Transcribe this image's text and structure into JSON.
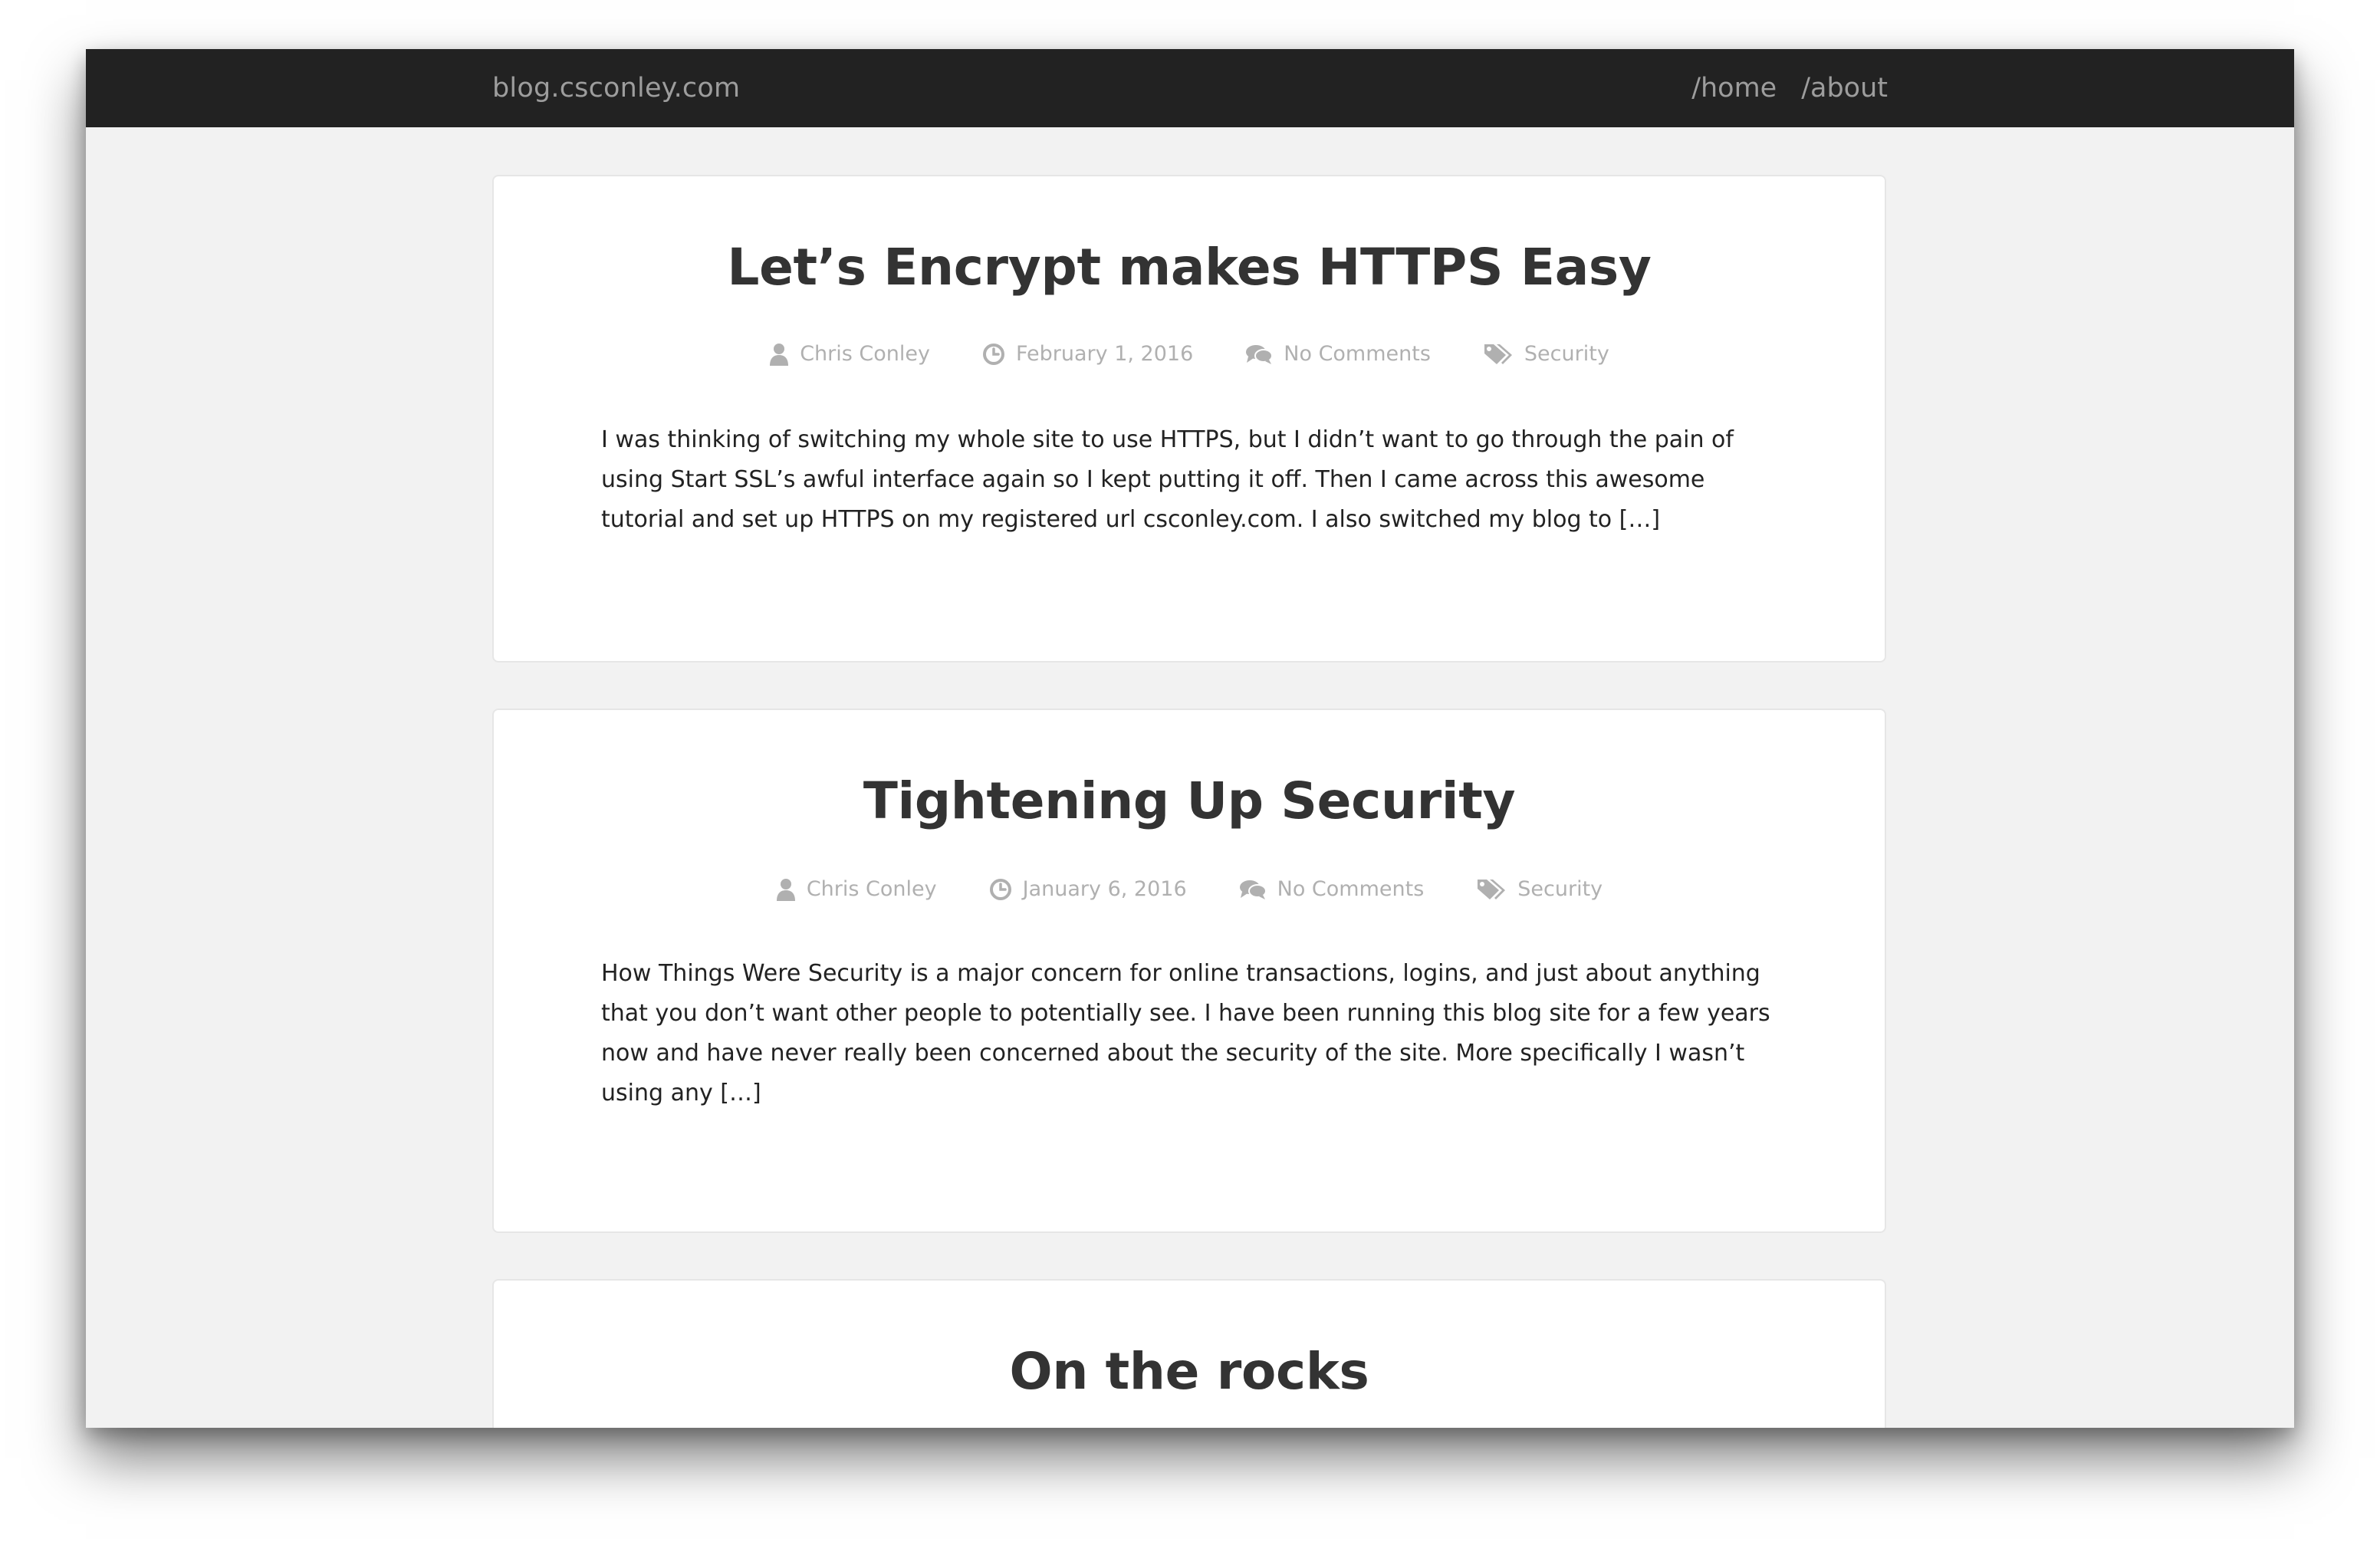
{
  "site": {
    "brand": "blog.csconley.com",
    "nav": [
      {
        "label": "/home"
      },
      {
        "label": "/about"
      }
    ]
  },
  "posts": [
    {
      "title": "Let’s Encrypt makes HTTPS Easy",
      "author": "Chris Conley",
      "date": "February 1, 2016",
      "comments": "No Comments",
      "category": "Security",
      "excerpt": "I was thinking of switching my whole site to use HTTPS, but I didn’t want to go through the pain of using Start SSL’s awful interface again so I kept putting it off. Then I came across this awesome tutorial and set up HTTPS on my registered url csconley.com. I also switched my blog to […]"
    },
    {
      "title": "Tightening Up Security",
      "author": "Chris Conley",
      "date": "January 6, 2016",
      "comments": "No Comments",
      "category": "Security",
      "excerpt": "How Things Were Security is a major concern for online transactions, logins, and just about anything that you don’t want other people to potentially see. I have been running this blog site for a few years now and have never really been concerned about the security of the site. More specifically I wasn’t using any […]"
    },
    {
      "title": "On the rocks"
    }
  ],
  "icons": {
    "author": "user-icon",
    "date": "clock-icon",
    "comments": "comments-icon",
    "category": "tags-icon"
  },
  "colors": {
    "navbar": "#222222",
    "nav_text": "#9d9d9d",
    "page_bg": "#f2f2f2",
    "card_bg": "#ffffff",
    "title": "#333333",
    "meta": "#b0b0b0",
    "body_text": "#222222"
  }
}
